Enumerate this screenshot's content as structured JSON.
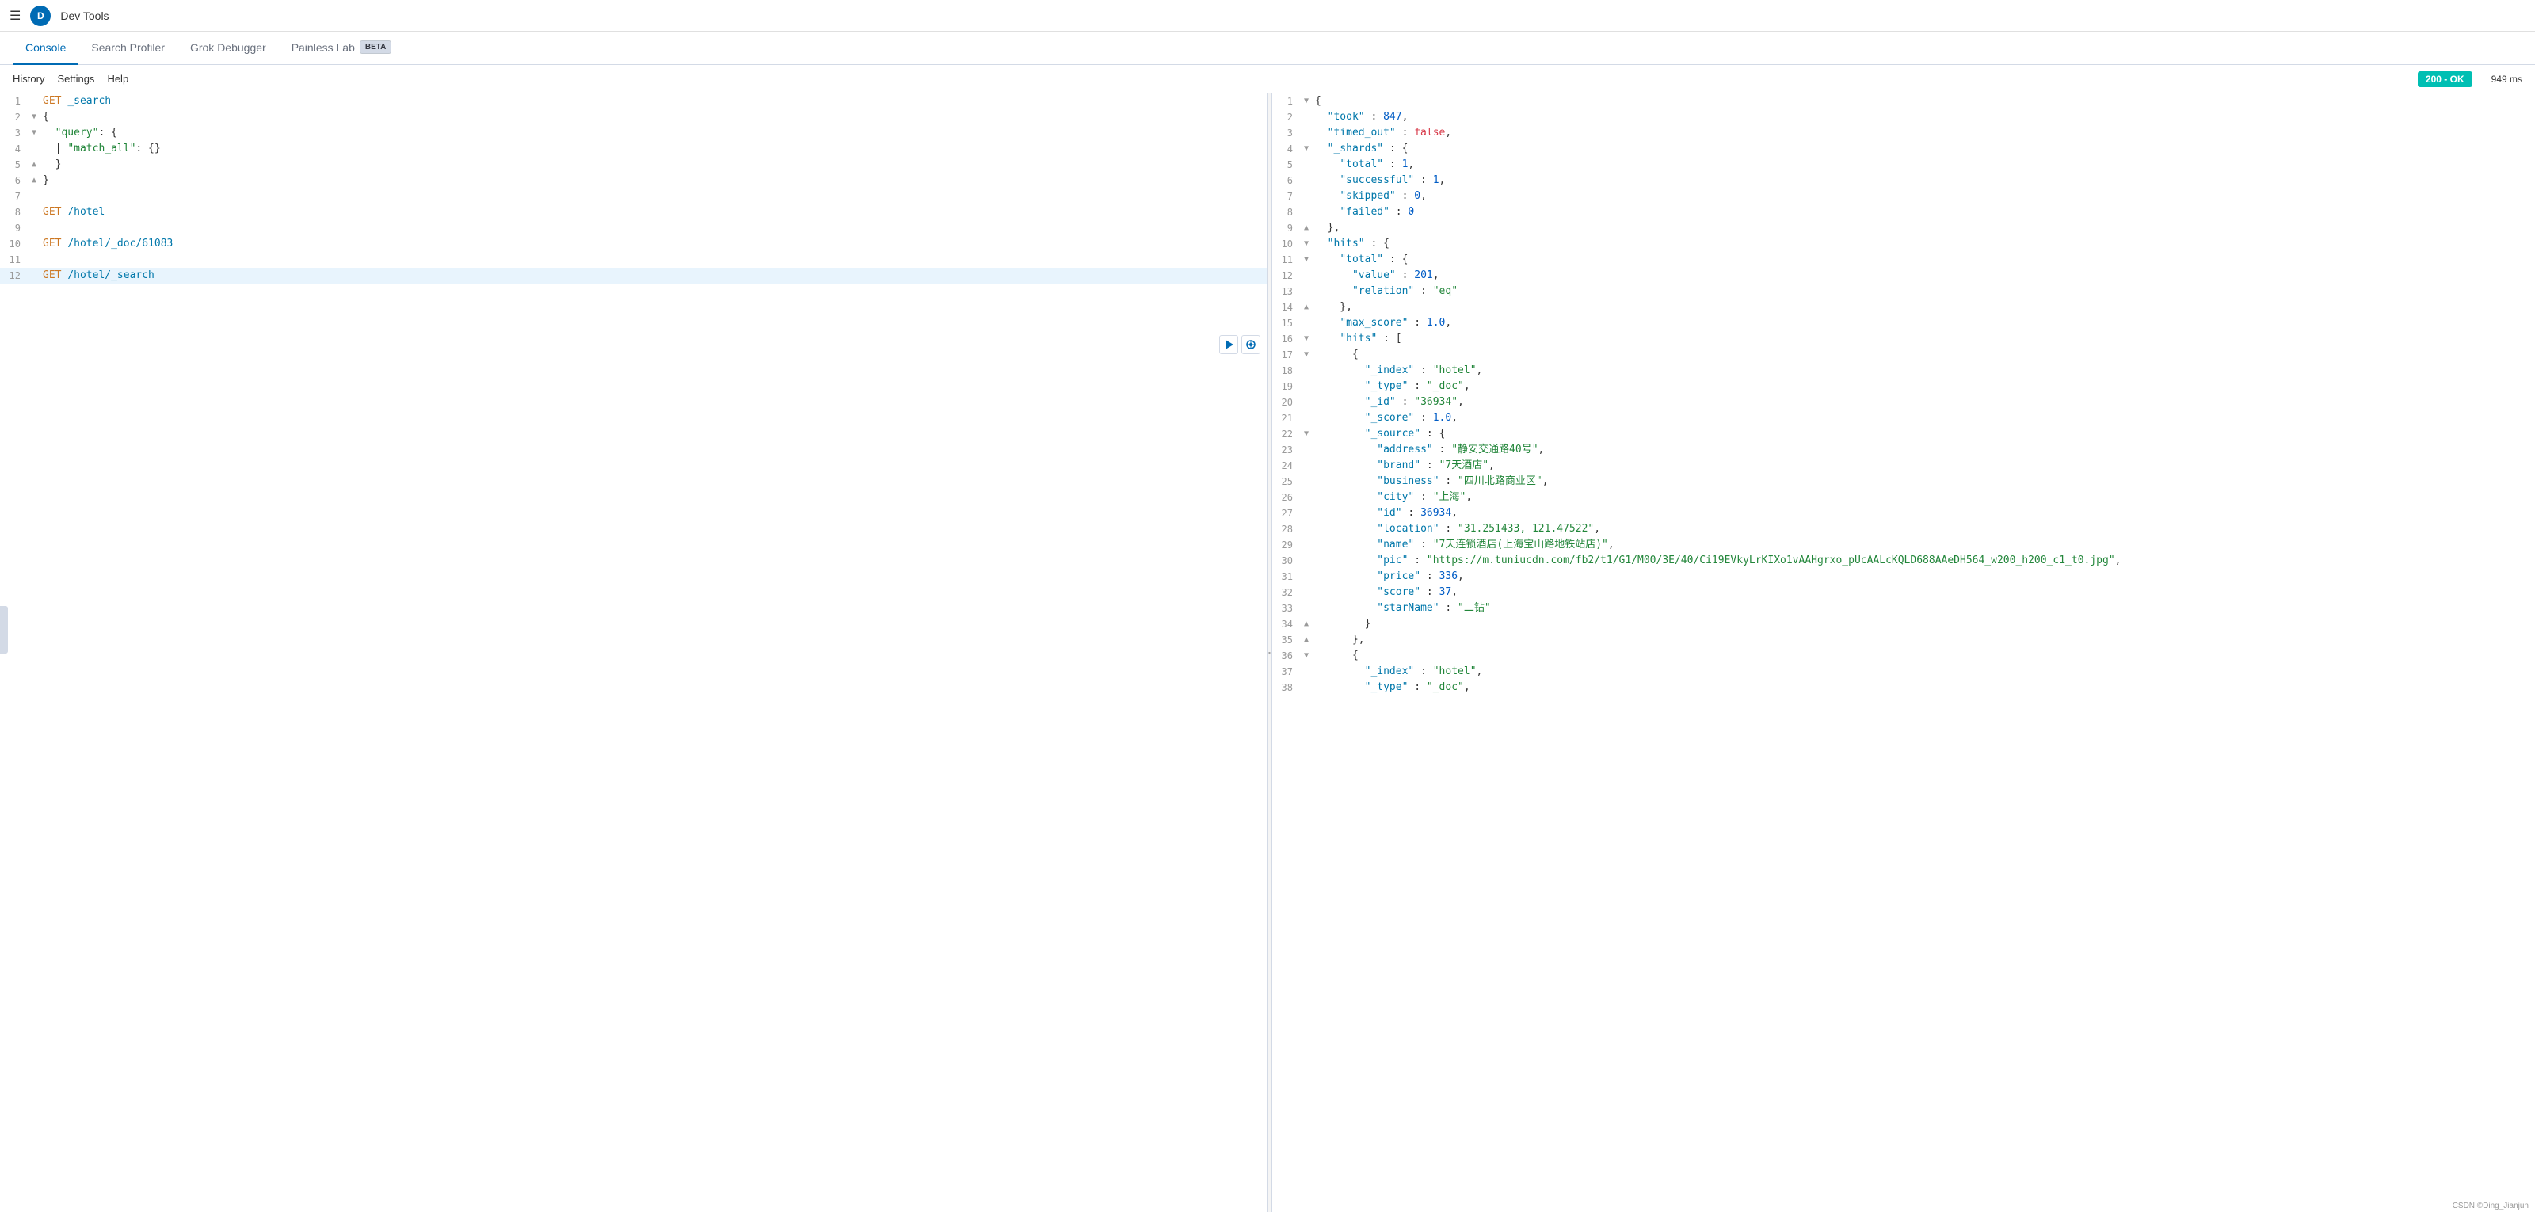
{
  "topBar": {
    "avatarLabel": "D",
    "appTitle": "Dev Tools"
  },
  "navTabs": [
    {
      "id": "console",
      "label": "Console",
      "active": true
    },
    {
      "id": "search-profiler",
      "label": "Search Profiler",
      "active": false
    },
    {
      "id": "grok-debugger",
      "label": "Grok Debugger",
      "active": false
    },
    {
      "id": "painless-lab",
      "label": "Painless Lab",
      "active": false,
      "badge": "BETA"
    }
  ],
  "toolbar": {
    "historyLabel": "History",
    "settingsLabel": "Settings",
    "helpLabel": "Help",
    "statusCode": "200 - OK",
    "responseTime": "949 ms"
  },
  "leftPanel": {
    "lines": [
      {
        "num": 1,
        "fold": "",
        "content": "GET _search",
        "active": false,
        "type": "request"
      },
      {
        "num": 2,
        "fold": "▼",
        "content": "{",
        "active": false,
        "type": "brace"
      },
      {
        "num": 3,
        "fold": "▼",
        "content": "  \"query\": {",
        "active": false,
        "type": "obj"
      },
      {
        "num": 4,
        "fold": "",
        "content": "  | \"match_all\": {}",
        "active": false,
        "type": "obj"
      },
      {
        "num": 5,
        "fold": "▲",
        "content": "  }",
        "active": false,
        "type": "brace"
      },
      {
        "num": 6,
        "fold": "▲",
        "content": "}",
        "active": false,
        "type": "brace"
      },
      {
        "num": 7,
        "fold": "",
        "content": "",
        "active": false,
        "type": "empty"
      },
      {
        "num": 8,
        "fold": "",
        "content": "GET /hotel",
        "active": false,
        "type": "request"
      },
      {
        "num": 9,
        "fold": "",
        "content": "",
        "active": false,
        "type": "empty"
      },
      {
        "num": 10,
        "fold": "",
        "content": "GET /hotel/_doc/61083",
        "active": false,
        "type": "request"
      },
      {
        "num": 11,
        "fold": "",
        "content": "",
        "active": false,
        "type": "empty"
      },
      {
        "num": 12,
        "fold": "",
        "content": "GET /hotel/_search",
        "active": true,
        "type": "request"
      }
    ]
  },
  "rightPanel": {
    "lines": [
      {
        "num": 1,
        "fold": "▼",
        "html": "{"
      },
      {
        "num": 2,
        "fold": "",
        "html": "  \"took\" : 847,"
      },
      {
        "num": 3,
        "fold": "",
        "html": "  \"timed_out\" : false,"
      },
      {
        "num": 4,
        "fold": "▼",
        "html": "  \"_shards\" : {"
      },
      {
        "num": 5,
        "fold": "",
        "html": "    \"total\" : 1,"
      },
      {
        "num": 6,
        "fold": "",
        "html": "    \"successful\" : 1,"
      },
      {
        "num": 7,
        "fold": "",
        "html": "    \"skipped\" : 0,"
      },
      {
        "num": 8,
        "fold": "",
        "html": "    \"failed\" : 0"
      },
      {
        "num": 9,
        "fold": "▲",
        "html": "  },"
      },
      {
        "num": 10,
        "fold": "▼",
        "html": "  \"hits\" : {"
      },
      {
        "num": 11,
        "fold": "▼",
        "html": "    \"total\" : {"
      },
      {
        "num": 12,
        "fold": "",
        "html": "      \"value\" : 201,"
      },
      {
        "num": 13,
        "fold": "",
        "html": "      \"relation\" : \"eq\""
      },
      {
        "num": 14,
        "fold": "▲",
        "html": "    },"
      },
      {
        "num": 15,
        "fold": "",
        "html": "    \"max_score\" : 1.0,"
      },
      {
        "num": 16,
        "fold": "▼",
        "html": "    \"hits\" : ["
      },
      {
        "num": 17,
        "fold": "▼",
        "html": "      {"
      },
      {
        "num": 18,
        "fold": "",
        "html": "        \"_index\" : \"hotel\","
      },
      {
        "num": 19,
        "fold": "",
        "html": "        \"_type\" : \"_doc\","
      },
      {
        "num": 20,
        "fold": "",
        "html": "        \"_id\" : \"36934\","
      },
      {
        "num": 21,
        "fold": "",
        "html": "        \"_score\" : 1.0,"
      },
      {
        "num": 22,
        "fold": "▼",
        "html": "        \"_source\" : {"
      },
      {
        "num": 23,
        "fold": "",
        "html": "          \"address\" : \"静安交通路40号\","
      },
      {
        "num": 24,
        "fold": "",
        "html": "          \"brand\" : \"7天酒店\","
      },
      {
        "num": 25,
        "fold": "",
        "html": "          \"business\" : \"四川北路商业区\","
      },
      {
        "num": 26,
        "fold": "",
        "html": "          \"city\" : \"上海\","
      },
      {
        "num": 27,
        "fold": "",
        "html": "          \"id\" : 36934,"
      },
      {
        "num": 28,
        "fold": "",
        "html": "          \"location\" : \"31.251433, 121.47522\","
      },
      {
        "num": 29,
        "fold": "",
        "html": "          \"name\" : \"7天连锁酒店(上海宝山路地铁站店)\","
      },
      {
        "num": 30,
        "fold": "",
        "html": "          \"pic\" : \"https://m.tuniucdn.com/fb2/t1/G1/M00/3E/40/Ci19EVkyLrKIXo1vAAHgrxo_pUcAALcKQLD688AAeDH564_w200_h200_c1_t0.jpg\","
      },
      {
        "num": 31,
        "fold": "",
        "html": "          \"price\" : 336,"
      },
      {
        "num": 32,
        "fold": "",
        "html": "          \"score\" : 37,"
      },
      {
        "num": 33,
        "fold": "",
        "html": "          \"starName\" : \"二钻\""
      },
      {
        "num": 34,
        "fold": "▲",
        "html": "        }"
      },
      {
        "num": 35,
        "fold": "▲",
        "html": "      },"
      },
      {
        "num": 36,
        "fold": "▼",
        "html": "      {"
      },
      {
        "num": 37,
        "fold": "",
        "html": "        \"_index\" : \"hotel\","
      },
      {
        "num": 38,
        "fold": "",
        "html": "        \"_type\" : \"_doc\","
      }
    ]
  },
  "copyright": "CSDN ©Ding_Jianjun"
}
